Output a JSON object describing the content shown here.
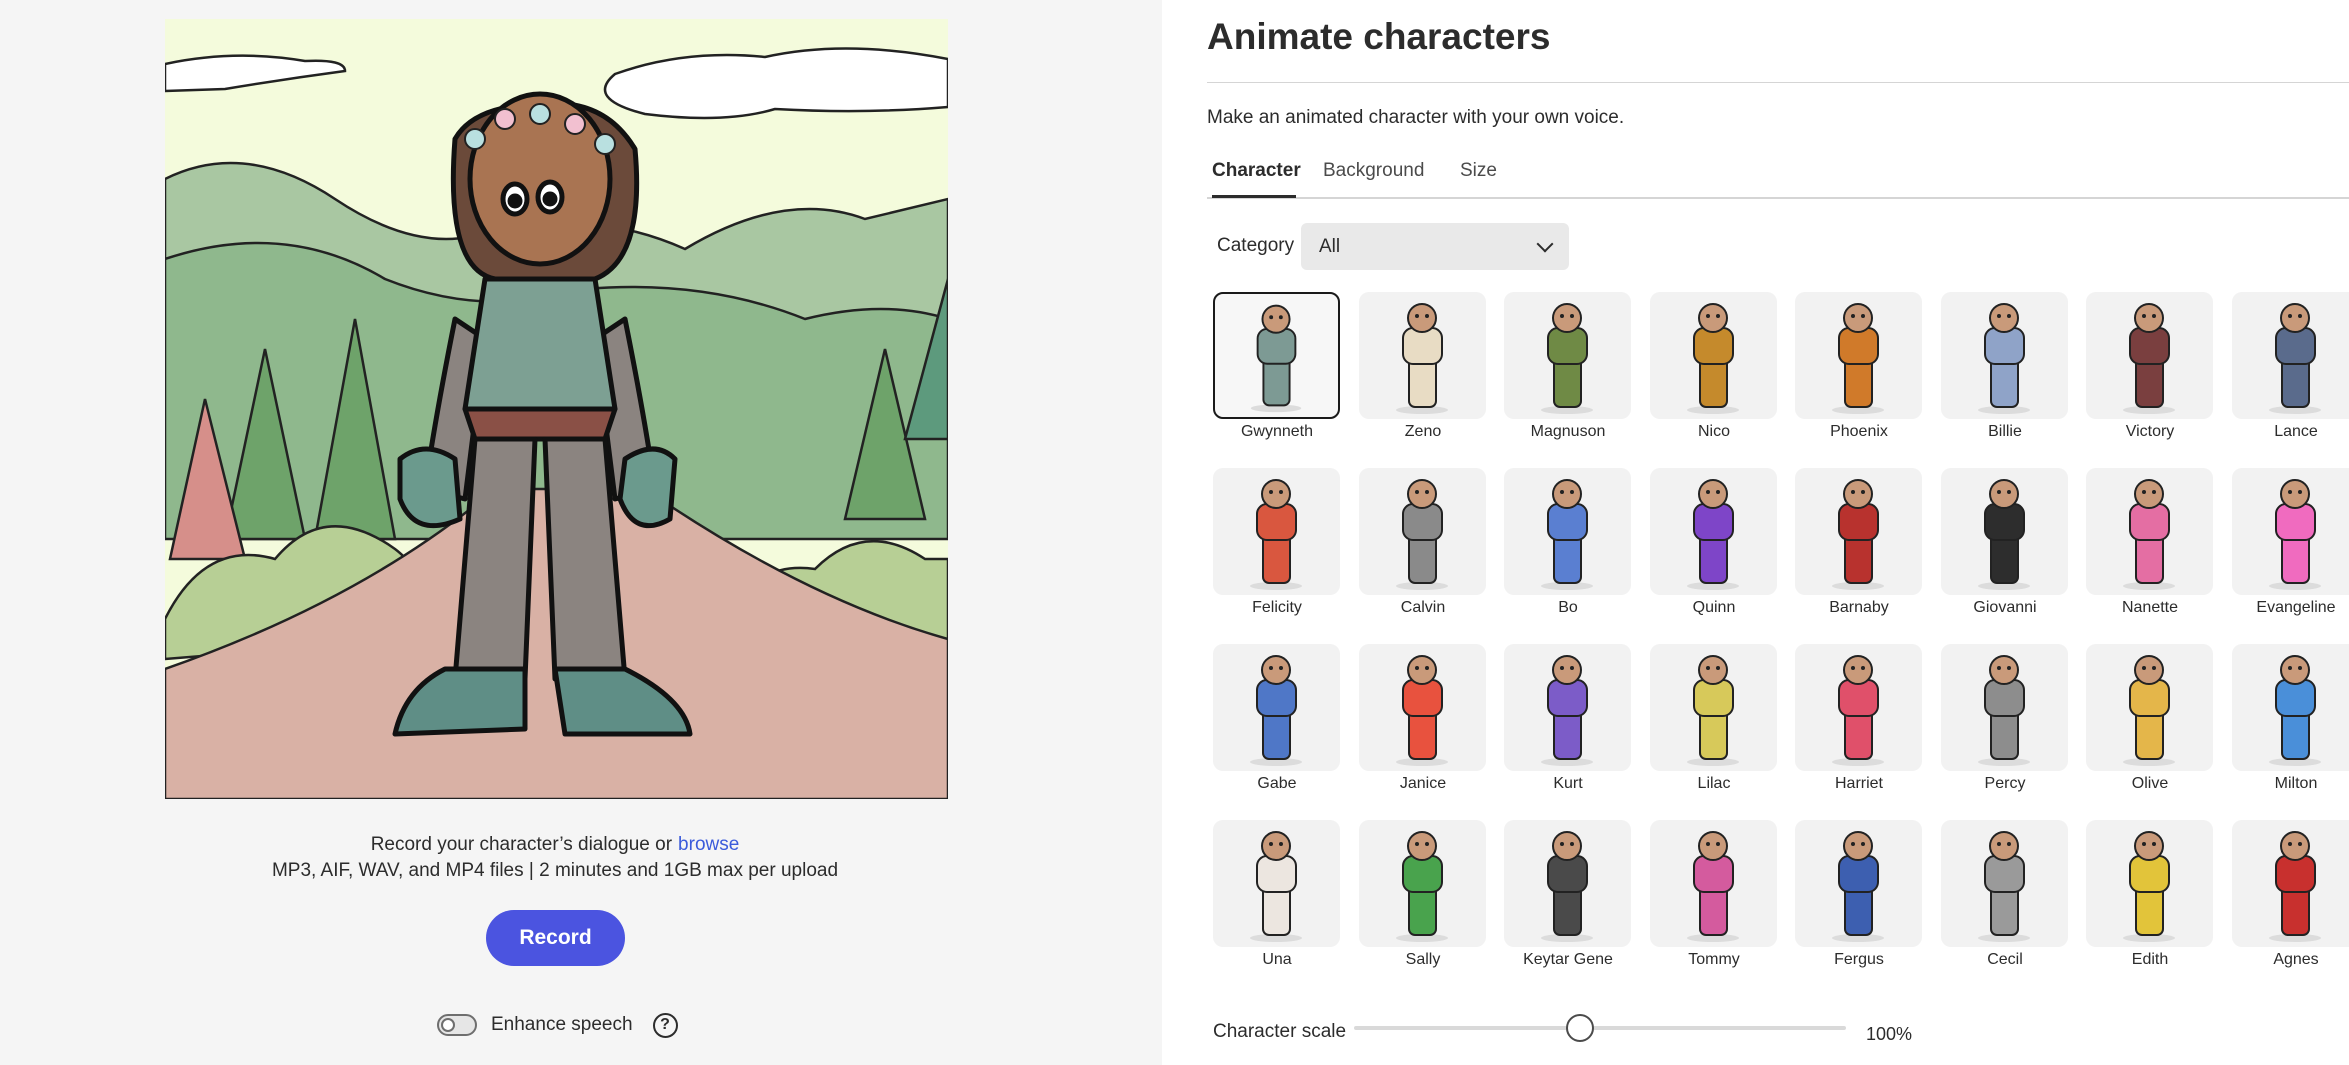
{
  "left": {
    "preview_character": "Gwynneth",
    "hint_text": "Record your character’s dialogue or",
    "browse_link": "browse",
    "formats_text": "MP3, AIF, WAV, and MP4 files | 2 minutes and 1GB max per upload",
    "record_label": "Record",
    "enhance_label": "Enhance speech",
    "enhance_on": false,
    "help_glyph": "?"
  },
  "right": {
    "title": "Animate characters",
    "subtitle": "Make an animated character with your own voice.",
    "tabs": [
      {
        "label": "Character",
        "active": true
      },
      {
        "label": "Background",
        "active": false
      },
      {
        "label": "Size",
        "active": false
      }
    ],
    "category_label": "Category",
    "category_value": "All",
    "characters": [
      {
        "name": "Gwynneth",
        "selected": true,
        "color": "#7d9a94"
      },
      {
        "name": "Zeno",
        "color": "#e8dcc4"
      },
      {
        "name": "Magnuson",
        "color": "#6f8a45"
      },
      {
        "name": "Nico",
        "color": "#c58a2c"
      },
      {
        "name": "Phoenix",
        "color": "#d07a2a"
      },
      {
        "name": "Billie",
        "color": "#8fa3c8"
      },
      {
        "name": "Victory",
        "color": "#7a3f3f"
      },
      {
        "name": "Lance",
        "color": "#5a6b8c"
      },
      {
        "name": "Felicity",
        "color": "#d9573f"
      },
      {
        "name": "Calvin",
        "color": "#8a8a8a"
      },
      {
        "name": "Bo",
        "color": "#5a7fd1"
      },
      {
        "name": "Quinn",
        "color": "#7e45c8"
      },
      {
        "name": "Barnaby",
        "color": "#b8322e"
      },
      {
        "name": "Giovanni",
        "color": "#2d2d2d"
      },
      {
        "name": "Nanette",
        "color": "#e46ea3"
      },
      {
        "name": "Evangeline",
        "color": "#f06bbf"
      },
      {
        "name": "Gabe",
        "color": "#4f77c7"
      },
      {
        "name": "Janice",
        "color": "#e8523e"
      },
      {
        "name": "Kurt",
        "color": "#7c5cc8"
      },
      {
        "name": "Lilac",
        "color": "#d7c95a"
      },
      {
        "name": "Harriet",
        "color": "#e0506a"
      },
      {
        "name": "Percy",
        "color": "#8d8d8d"
      },
      {
        "name": "Olive",
        "color": "#e4b64a"
      },
      {
        "name": "Milton",
        "color": "#4a8fd9"
      },
      {
        "name": "Una",
        "color": "#ece6e0"
      },
      {
        "name": "Sally",
        "color": "#49a34d"
      },
      {
        "name": "Keytar Gene",
        "color": "#4a4a4a"
      },
      {
        "name": "Tommy",
        "color": "#d45b9e"
      },
      {
        "name": "Fergus",
        "color": "#3d5fb0"
      },
      {
        "name": "Cecil",
        "color": "#9a9a9a"
      },
      {
        "name": "Edith",
        "color": "#e2c43a"
      },
      {
        "name": "Agnes",
        "color": "#c8302e"
      }
    ],
    "scale_label": "Character scale",
    "scale_value": "100%",
    "scale_fraction": 0.5
  },
  "colors": {
    "accent": "#4b54e0",
    "link": "#3b5bdb"
  }
}
